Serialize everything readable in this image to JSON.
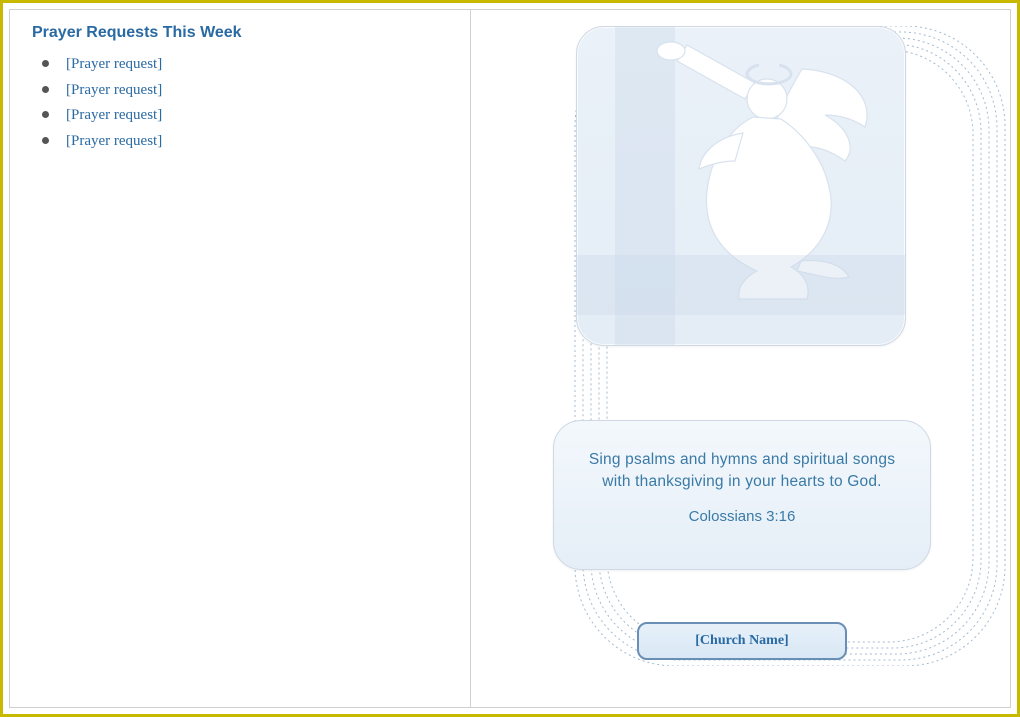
{
  "left": {
    "title": "Prayer Requests This Week",
    "requests": [
      "[Prayer request]",
      "[Prayer request]",
      "[Prayer request]",
      "[Prayer request]"
    ]
  },
  "right": {
    "verse": "Sing psalms and hymns and spiritual songs with thanksgiving in your hearts to God.",
    "verse_cite": "Colossians 3:16",
    "church_name": "[Church Name]"
  },
  "colors": {
    "frame": "#c9b800",
    "accent_text": "#2a6aa3",
    "card_border": "#6a8fb7"
  }
}
